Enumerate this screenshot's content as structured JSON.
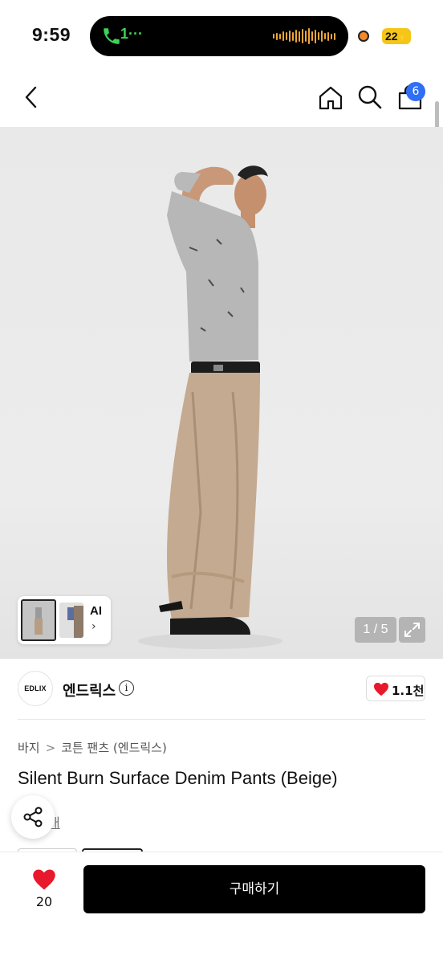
{
  "status_bar": {
    "time": "9:59",
    "call_text": "1···",
    "battery": "22"
  },
  "header": {
    "cart_count": "6",
    "icons": [
      "back-icon",
      "home-icon",
      "search-icon",
      "cart-icon"
    ]
  },
  "gallery": {
    "ai_label": "AI",
    "ai_chevron": "›",
    "counter": "1 / 5"
  },
  "brand": {
    "logo_text": "EDLIX",
    "name": "엔드릭스",
    "info_glyph": "i",
    "like_count": "1.1천"
  },
  "product": {
    "breadcrumb": [
      "바지",
      "코튼 팬츠 (엔드릭스)"
    ],
    "breadcrumb_sep": ">",
    "title": "Silent Burn Surface Denim Pants (Beige)",
    "review_text": "개"
  },
  "bottom_bar": {
    "wish_count": "20",
    "buy_label": "구매하기"
  },
  "colors": {
    "accent_blue": "#2f6ef5",
    "heart_red": "#e8192c",
    "buy_button": "#000000"
  }
}
